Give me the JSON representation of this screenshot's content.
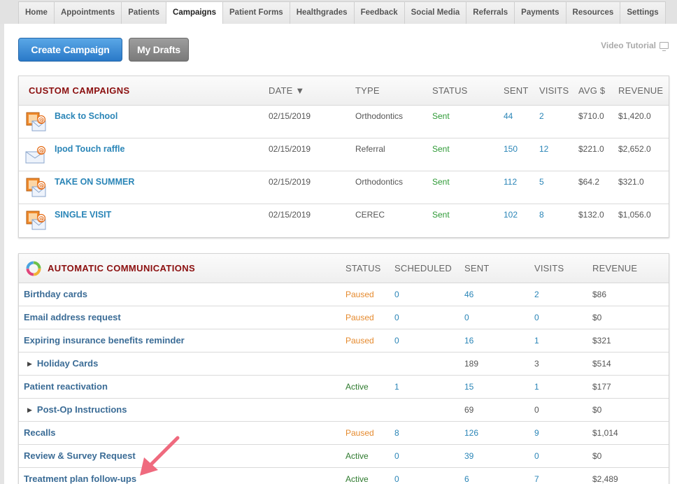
{
  "nav": {
    "tabs": [
      "Home",
      "Appointments",
      "Patients",
      "Campaigns",
      "Patient Forms",
      "Healthgrades",
      "Feedback",
      "Social Media",
      "Referrals",
      "Payments",
      "Resources",
      "Settings"
    ],
    "active_tab": "Campaigns"
  },
  "toolbar": {
    "create_label": "Create Campaign",
    "drafts_label": "My Drafts",
    "video_label": "Video Tutorial"
  },
  "colors": {
    "accent_blue": "#2a79c8",
    "title_red": "#8b0f0f",
    "status_sent": "#2e9a36",
    "status_paused": "#e58a2e",
    "link": "#2a85b7",
    "pointer_arrow": "#ef6a7e"
  },
  "custom": {
    "title": "CUSTOM CAMPAIGNS",
    "headers": {
      "date": "DATE ▼",
      "type": "TYPE",
      "status": "STATUS",
      "sent": "SENT",
      "visits": "VISITS",
      "avg": "AVG $",
      "revenue": "REVENUE"
    },
    "rows": [
      {
        "icon": "campaign-envelope-photo-icon",
        "name": "Back to School",
        "date": "02/15/2019",
        "type": "Orthodontics",
        "status": "Sent",
        "sent": "44",
        "visits": "2",
        "avg": "$710.0",
        "revenue": "$1,420.0"
      },
      {
        "icon": "campaign-envelope-icon",
        "name": "Ipod Touch raffle",
        "date": "02/15/2019",
        "type": "Referral",
        "status": "Sent",
        "sent": "150",
        "visits": "12",
        "avg": "$221.0",
        "revenue": "$2,652.0"
      },
      {
        "icon": "campaign-envelope-photo-icon",
        "name": "TAKE ON SUMMER",
        "date": "02/15/2019",
        "type": "Orthodontics",
        "status": "Sent",
        "sent": "112",
        "visits": "5",
        "avg": "$64.2",
        "revenue": "$321.0"
      },
      {
        "icon": "campaign-envelope-photo-icon",
        "name": "SINGLE VISIT",
        "date": "02/15/2019",
        "type": "CEREC",
        "status": "Sent",
        "sent": "102",
        "visits": "8",
        "avg": "$132.0",
        "revenue": "$1,056.0"
      }
    ]
  },
  "auto": {
    "title": "AUTOMATIC COMMUNICATIONS",
    "headers": {
      "status": "STATUS",
      "scheduled": "SCHEDULED",
      "sent": "SENT",
      "visits": "VISITS",
      "revenue": "REVENUE"
    },
    "rows": [
      {
        "name": "Birthday cards",
        "expandable": false,
        "status": "Paused",
        "scheduled": "0",
        "sent": "46",
        "visits": "2",
        "revenue": "$86"
      },
      {
        "name": "Email address request",
        "expandable": false,
        "status": "Paused",
        "scheduled": "0",
        "sent": "0",
        "visits": "0",
        "revenue": "$0"
      },
      {
        "name": "Expiring insurance benefits reminder",
        "expandable": false,
        "status": "Paused",
        "scheduled": "0",
        "sent": "16",
        "visits": "1",
        "revenue": "$321"
      },
      {
        "name": "Holiday Cards",
        "expandable": true,
        "status": "",
        "scheduled": "",
        "sent": "189",
        "visits": "3",
        "revenue": "$514"
      },
      {
        "name": "Patient reactivation",
        "expandable": false,
        "status": "Active",
        "scheduled": "1",
        "sent": "15",
        "visits": "1",
        "revenue": "$177"
      },
      {
        "name": "Post-Op Instructions",
        "expandable": true,
        "status": "",
        "scheduled": "",
        "sent": "69",
        "visits": "0",
        "revenue": "$0"
      },
      {
        "name": "Recalls",
        "expandable": false,
        "status": "Paused",
        "scheduled": "8",
        "sent": "126",
        "visits": "9",
        "revenue": "$1,014"
      },
      {
        "name": "Review & Survey Request",
        "expandable": false,
        "status": "Active",
        "scheduled": "0",
        "sent": "39",
        "visits": "0",
        "revenue": "$0"
      },
      {
        "name": "Treatment plan follow-ups",
        "expandable": false,
        "status": "Active",
        "scheduled": "0",
        "sent": "6",
        "visits": "7",
        "revenue": "$2,489"
      }
    ]
  }
}
